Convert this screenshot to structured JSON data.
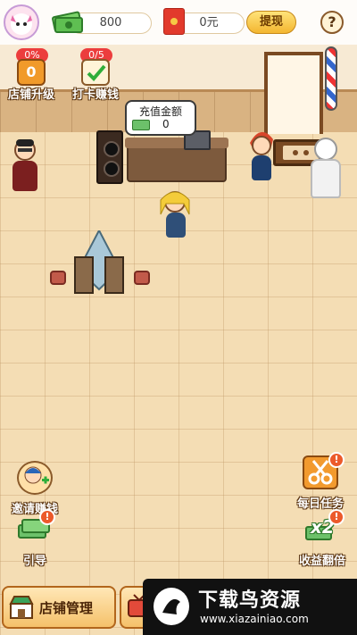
{
  "topbar": {
    "cash_value": "800",
    "redpacket_value": "0元",
    "withdraw_label": "提现",
    "help_label": "?"
  },
  "features": {
    "shop_upgrade": {
      "label": "店铺升级",
      "badge": "0%",
      "level": "0"
    },
    "checkin": {
      "label": "打卡赚钱",
      "badge": "0/5"
    }
  },
  "counter_bubble": {
    "title": "充值金额",
    "value": "0"
  },
  "side_left": [
    {
      "label": "邀请赚钱"
    },
    {
      "label": "引导",
      "alert": "!"
    }
  ],
  "side_right": [
    {
      "label": "每日任务",
      "alert": "!"
    },
    {
      "label": "收益翻倍",
      "alert": "!",
      "multiplier": "x2"
    }
  ],
  "bottom": {
    "shop_manage_label": "店铺管理"
  },
  "watermark": {
    "title": "下载鸟资源",
    "url": "www.xiazainiao.com"
  },
  "colors": {
    "accent_gold": "#f3b630",
    "alert_red": "#ec3d3d",
    "wood_brown": "#7a4a22"
  }
}
